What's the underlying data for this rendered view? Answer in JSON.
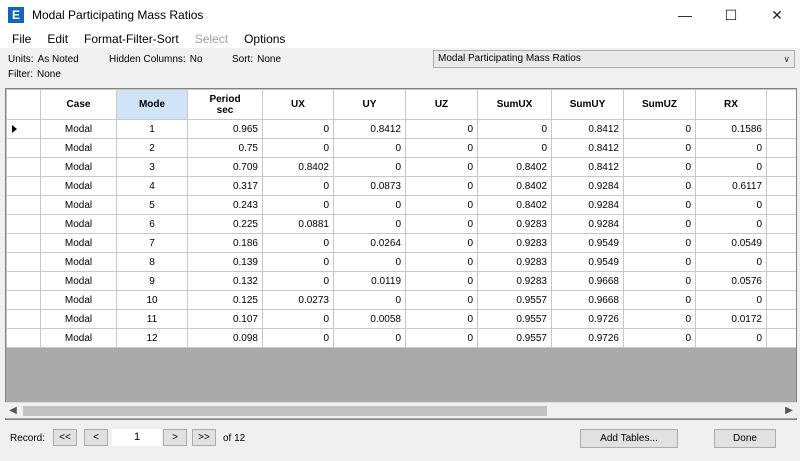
{
  "window": {
    "title": "Modal Participating Mass Ratios",
    "app_icon": "E"
  },
  "menu": [
    "File",
    "Edit",
    "Format-Filter-Sort",
    "Select",
    "Options"
  ],
  "info": {
    "units_label": "Units:",
    "units_value": "As Noted",
    "filter_label": "Filter:",
    "filter_value": "None",
    "hidden_label": "Hidden Columns:",
    "hidden_value": "No",
    "sort_label": "Sort:",
    "sort_value": "None"
  },
  "table_select": {
    "value": "Modal Participating Mass Ratios"
  },
  "grid": {
    "columns": [
      "Case",
      "Mode",
      "Period\nsec",
      "UX",
      "UY",
      "UZ",
      "SumUX",
      "SumUY",
      "SumUZ",
      "RX"
    ],
    "selected_column": "Mode",
    "rows": [
      [
        "Modal",
        "1",
        "0.965",
        "0",
        "0.8412",
        "0",
        "0",
        "0.8412",
        "0",
        "0.1586"
      ],
      [
        "Modal",
        "2",
        "0.75",
        "0",
        "0",
        "0",
        "0",
        "0.8412",
        "0",
        "0"
      ],
      [
        "Modal",
        "3",
        "0.709",
        "0.8402",
        "0",
        "0",
        "0.8402",
        "0.8412",
        "0",
        "0"
      ],
      [
        "Modal",
        "4",
        "0.317",
        "0",
        "0.0873",
        "0",
        "0.8402",
        "0.9284",
        "0",
        "0.6117"
      ],
      [
        "Modal",
        "5",
        "0.243",
        "0",
        "0",
        "0",
        "0.8402",
        "0.9284",
        "0",
        "0"
      ],
      [
        "Modal",
        "6",
        "0.225",
        "0.0881",
        "0",
        "0",
        "0.9283",
        "0.9284",
        "0",
        "0"
      ],
      [
        "Modal",
        "7",
        "0.186",
        "0",
        "0.0264",
        "0",
        "0.9283",
        "0.9549",
        "0",
        "0.0549"
      ],
      [
        "Modal",
        "8",
        "0.139",
        "0",
        "0",
        "0",
        "0.9283",
        "0.9549",
        "0",
        "0"
      ],
      [
        "Modal",
        "9",
        "0.132",
        "0",
        "0.0119",
        "0",
        "0.9283",
        "0.9668",
        "0",
        "0.0576"
      ],
      [
        "Modal",
        "10",
        "0.125",
        "0.0273",
        "0",
        "0",
        "0.9557",
        "0.9668",
        "0",
        "0"
      ],
      [
        "Modal",
        "11",
        "0.107",
        "0",
        "0.0058",
        "0",
        "0.9557",
        "0.9726",
        "0",
        "0.0172"
      ],
      [
        "Modal",
        "12",
        "0.098",
        "0",
        "0",
        "0",
        "0.9557",
        "0.9726",
        "0",
        "0"
      ]
    ]
  },
  "footer": {
    "record_label": "Record:",
    "first": "<<",
    "prev": "<",
    "next": ">",
    "last": ">>",
    "record_value": "1",
    "of_label": "of 12",
    "add_tables": "Add Tables...",
    "done": "Done"
  }
}
